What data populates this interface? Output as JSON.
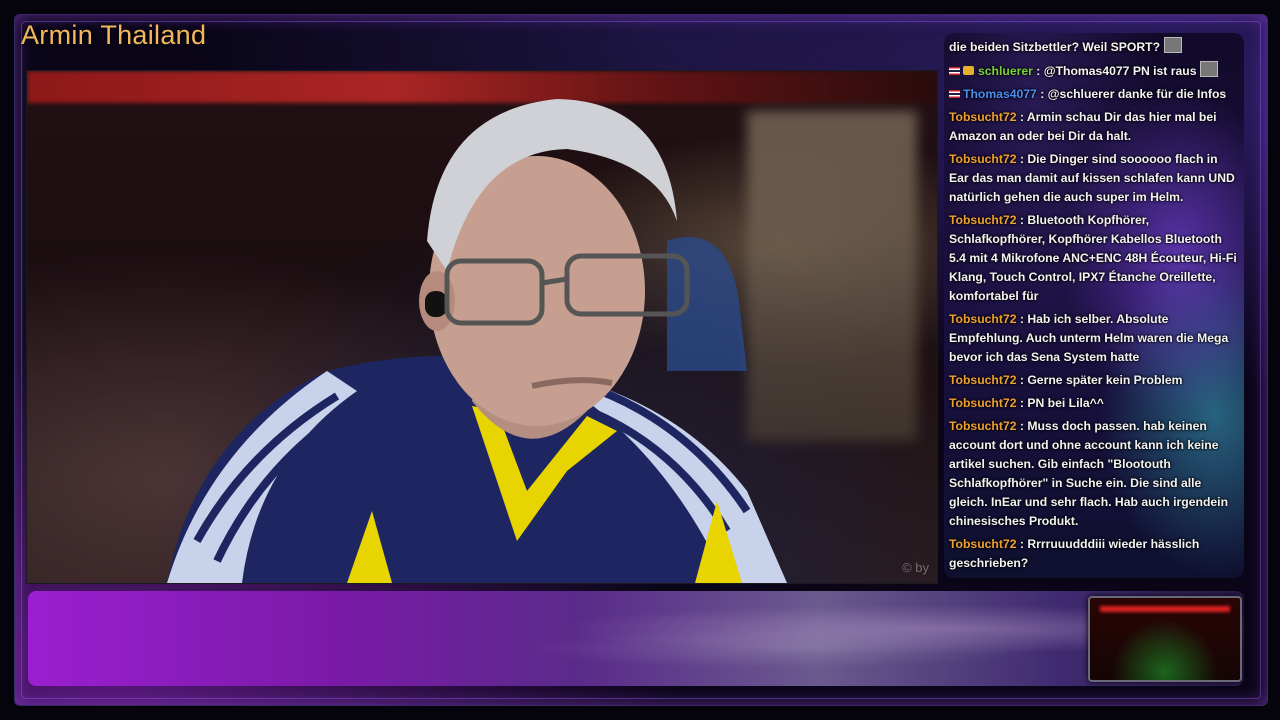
{
  "stream": {
    "title": "Armin Thailand",
    "watermark": "© by"
  },
  "chat": {
    "messages": [
      {
        "user": "",
        "user_color": "#ffffff",
        "text": "die beiden Sitzbettler? Weil SPORT?",
        "flag": false,
        "badge": false,
        "emote": true
      },
      {
        "user": "schluerer",
        "user_color": "#7bd23a",
        "text": " : @Thomas4077 PN ist raus",
        "flag": true,
        "badge": true,
        "emote": true
      },
      {
        "user": "Thomas4077",
        "user_color": "#4a8ef0",
        "text": " : @schluerer danke für die Infos",
        "flag": true,
        "badge": false,
        "emote": false
      },
      {
        "user": "Tobsucht72",
        "user_color": "#f0a030",
        "text": " : Armin schau Dir das hier mal bei Amazon an oder bei Dir da halt.",
        "flag": false,
        "badge": false,
        "emote": false
      },
      {
        "user": "Tobsucht72",
        "user_color": "#f0a030",
        "text": " : Die Dinger sind soooooo flach in Ear das man damit auf kissen schlafen kann UND natürlich gehen die auch super im Helm.",
        "flag": false,
        "badge": false,
        "emote": false
      },
      {
        "user": "Tobsucht72",
        "user_color": "#f0a030",
        "text": " : Bluetooth Kopfhörer, Schlafkopfhörer, Kopfhörer Kabellos Bluetooth 5.4 mit 4 Mikrofone ANC+ENC 48H Écouteur, Hi-Fi Klang, Touch Control, IPX7 Étanche Oreillette, komfortabel für",
        "flag": false,
        "badge": false,
        "emote": false
      },
      {
        "user": "Tobsucht72",
        "user_color": "#f0a030",
        "text": " : Hab ich selber. Absolute Empfehlung. Auch unterm Helm waren die Mega bevor ich das Sena System hatte",
        "flag": false,
        "badge": false,
        "emote": false
      },
      {
        "user": "Tobsucht72",
        "user_color": "#f0a030",
        "text": " : Gerne später kein Problem",
        "flag": false,
        "badge": false,
        "emote": false
      },
      {
        "user": "Tobsucht72",
        "user_color": "#f0a030",
        "text": " : PN bei Lila^^",
        "flag": false,
        "badge": false,
        "emote": false
      },
      {
        "user": "Tobsucht72",
        "user_color": "#f0a030",
        "text": " : Muss doch passen. hab keinen account dort und ohne account kann ich keine artikel suchen. Gib einfach \"Blootouth Schlafkopfhörer\" in Suche ein. Die sind alle gleich. InEar und sehr flach. Hab auch irgendein chinesisches Produkt.",
        "flag": false,
        "badge": false,
        "emote": false
      },
      {
        "user": "Tobsucht72",
        "user_color": "#f0a030",
        "text": " : Rrrruuudddiii wieder hässlich geschrieben?",
        "flag": false,
        "badge": false,
        "emote": false
      }
    ]
  }
}
